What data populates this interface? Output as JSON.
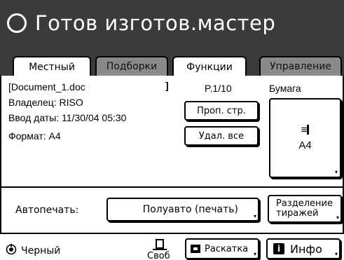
{
  "status": {
    "title": "Готов изготов.мастер"
  },
  "tabs": [
    {
      "label": "Местный",
      "active": true
    },
    {
      "label": "Подборки",
      "active": false
    },
    {
      "label": "Функции",
      "active": true
    },
    {
      "label": "Управление",
      "active": false
    }
  ],
  "document": {
    "name_line": "[Document_1.doc",
    "bracket_close": "]",
    "owner": "Владелец: RISO",
    "date": "Ввод даты: 11/30/04 05:30",
    "format": "Формат: A4"
  },
  "page_number": "P.1/10",
  "buttons": {
    "proof": "Проп. стр.",
    "delete_all": "Удал. все",
    "auto_value": "Полуавто (печать)",
    "split_line1": "Разделение",
    "split_line2": "тиражей",
    "rask": "Раскатка",
    "info": "Инфо"
  },
  "paper": {
    "label": "Бумага",
    "size": "A4"
  },
  "autoprint": {
    "label": "Автопечать:"
  },
  "bottom": {
    "ink": "Черный",
    "free": "Своб"
  },
  "colors": {
    "topbar": "#3b3b3b",
    "inactive_tab": "#8a8a8a"
  }
}
